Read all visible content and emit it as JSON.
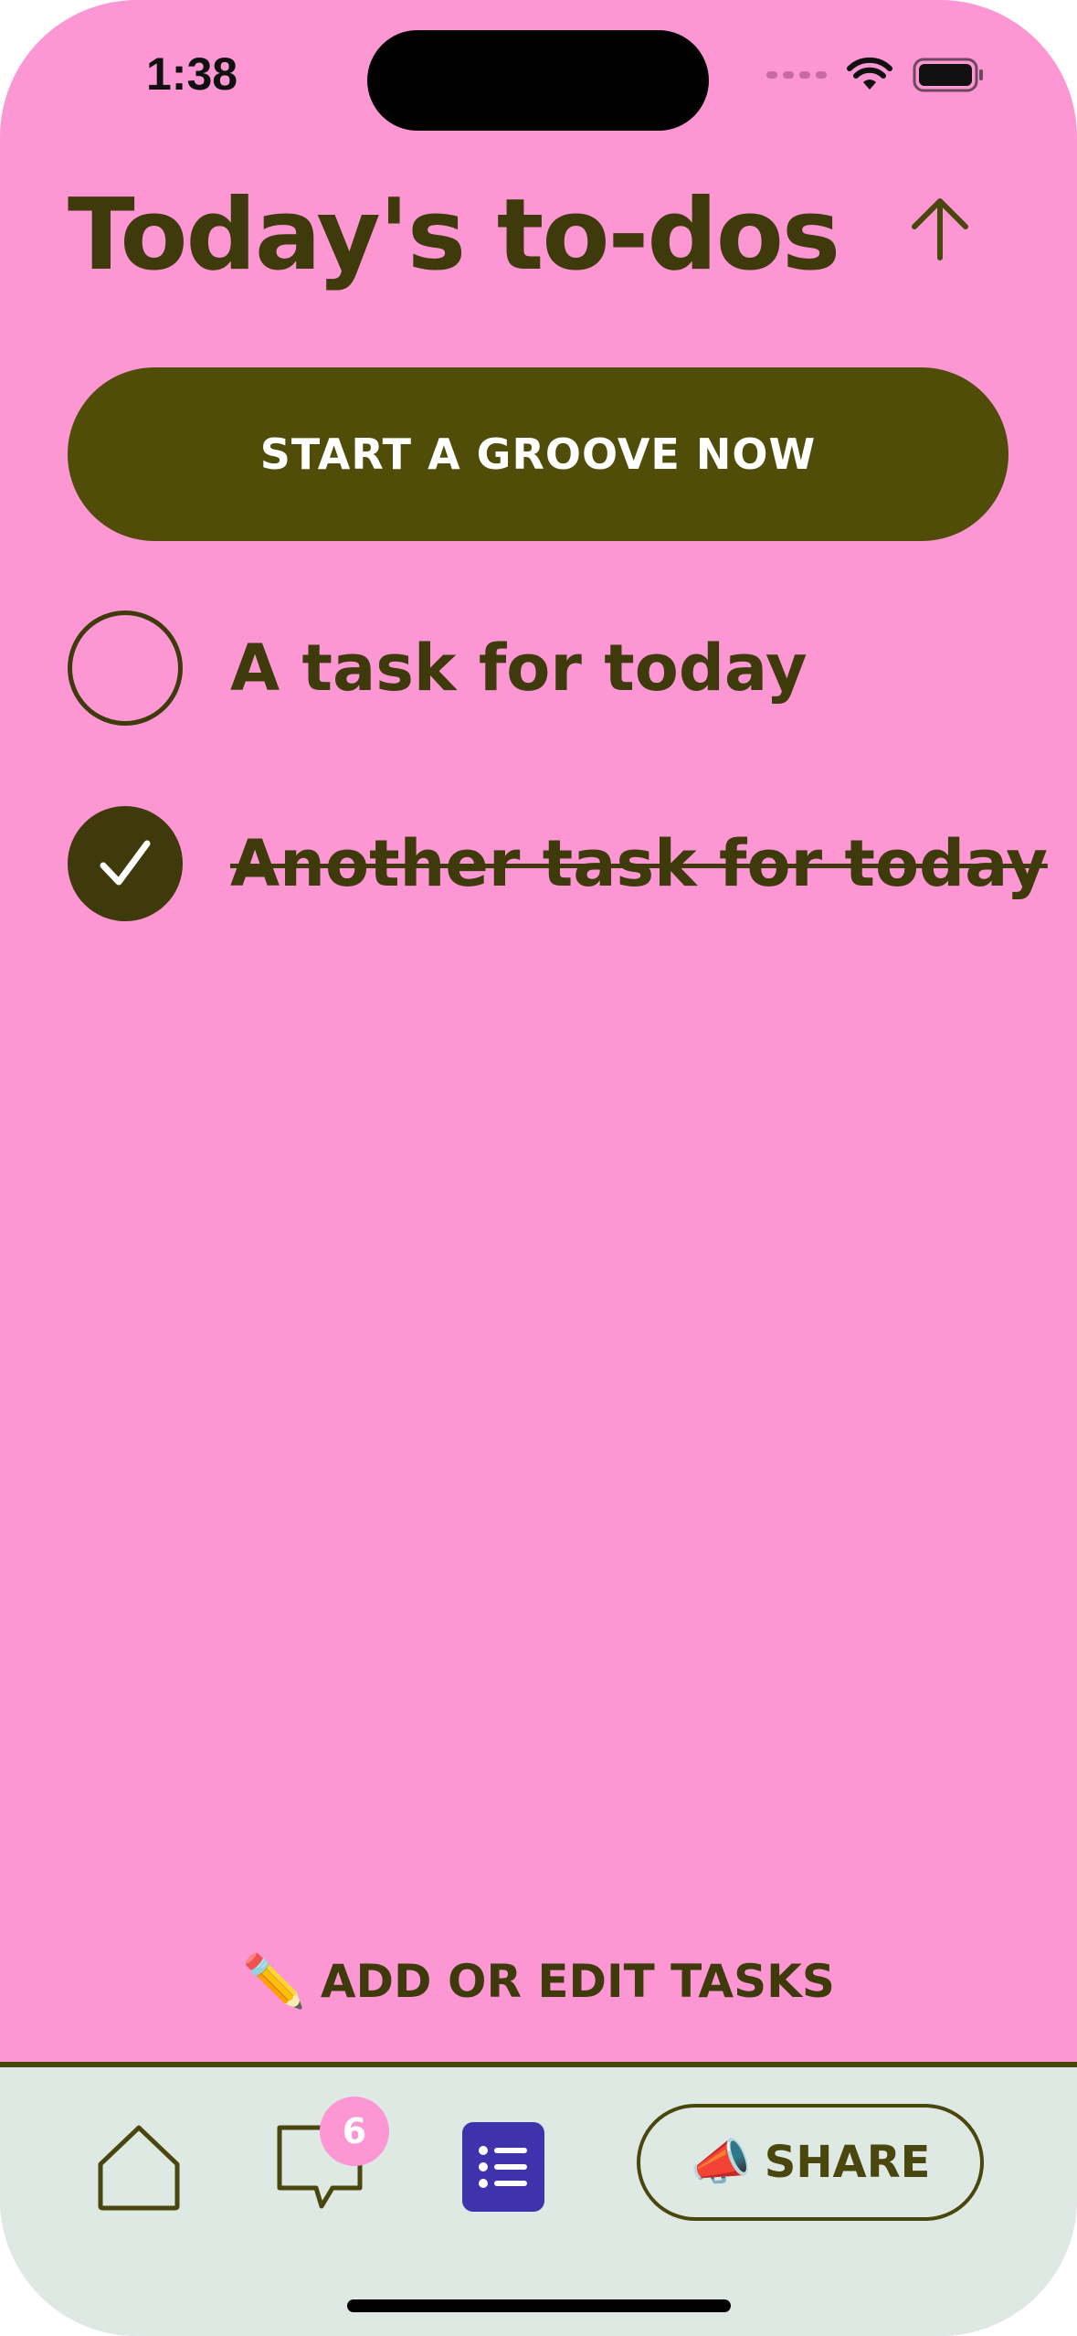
{
  "status_bar": {
    "time": "1:38"
  },
  "header": {
    "title": "Today's to-dos",
    "collapse_icon": "arrow-up-icon"
  },
  "primary_action": {
    "label": "START A GROOVE NOW"
  },
  "tasks": [
    {
      "label": "A task for today",
      "completed": false
    },
    {
      "label": "Another task for today",
      "completed": true
    }
  ],
  "add_edit": {
    "icon": "pencil-icon",
    "label": "ADD OR EDIT TASKS"
  },
  "tabbar": {
    "home_icon": "home-icon",
    "chat_icon": "chat-bubble-icon",
    "chat_badge": "6",
    "list_icon": "list-icon",
    "share_icon": "megaphone-icon",
    "share_label": "SHARE"
  },
  "colors": {
    "background": "#fd97d3",
    "text": "#3e3a0b",
    "button": "#504d09",
    "tabbar": "#dfe9e4",
    "active_tab": "#3f33ad"
  }
}
